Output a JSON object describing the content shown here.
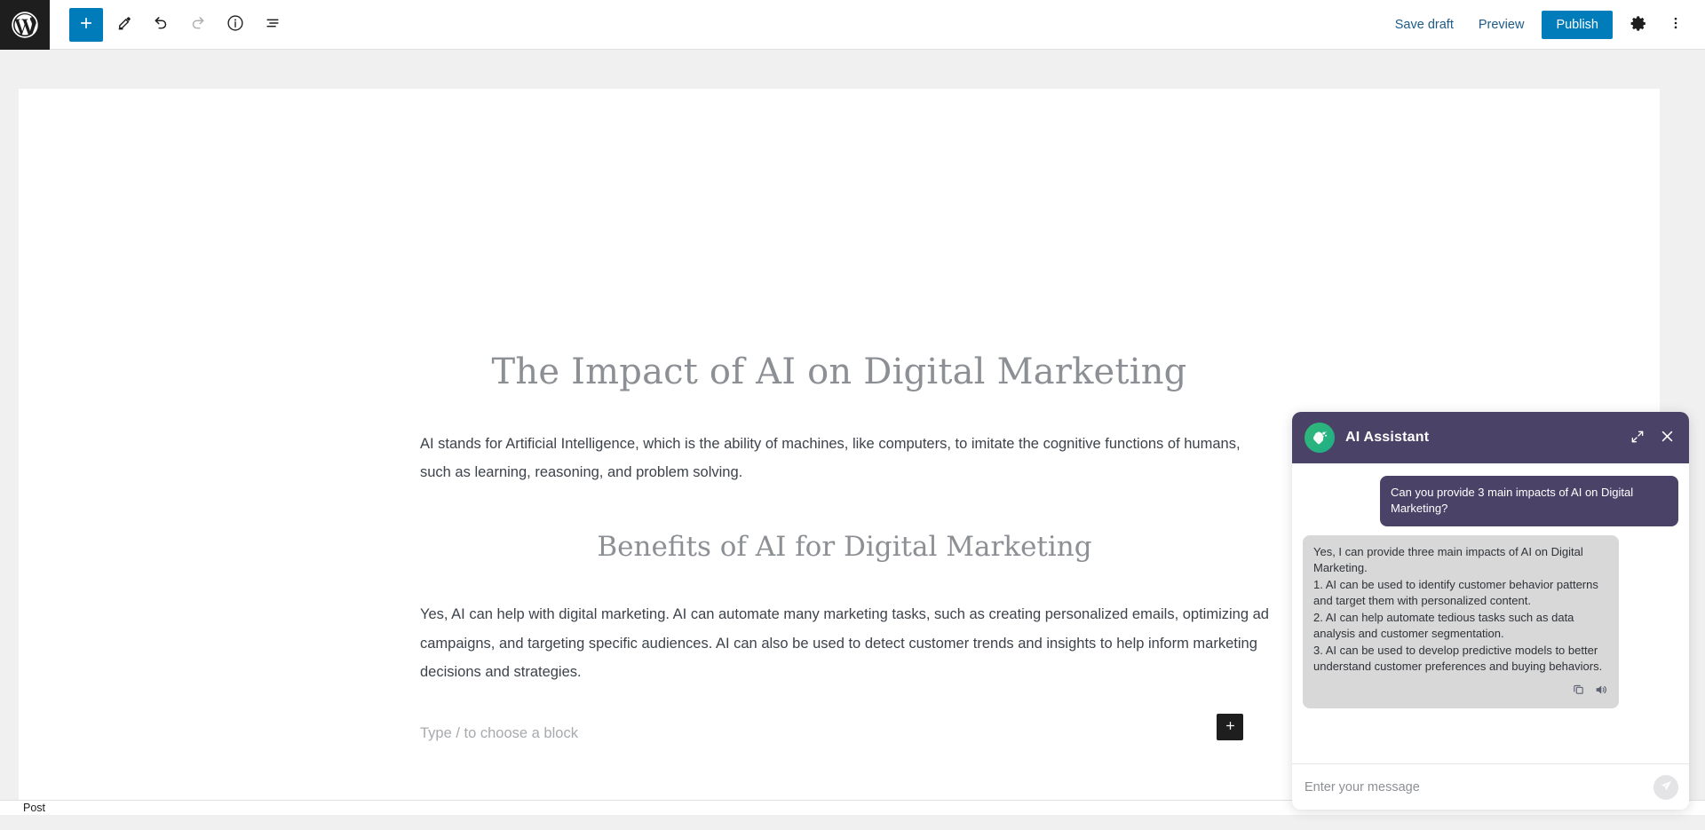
{
  "topbar": {
    "logo_icon": "wordpress-logo-icon",
    "tools": [
      {
        "name": "add-block-button",
        "icon": "plus-icon",
        "label": "Add block",
        "primary": true,
        "disabled": false
      },
      {
        "name": "tools-button",
        "icon": "pencil-icon",
        "label": "Tools",
        "primary": false,
        "disabled": false
      },
      {
        "name": "undo-button",
        "icon": "undo-arrow-icon",
        "label": "Undo",
        "primary": false,
        "disabled": false
      },
      {
        "name": "redo-button",
        "icon": "redo-arrow-icon",
        "label": "Redo",
        "primary": false,
        "disabled": true
      },
      {
        "name": "details-button",
        "icon": "info-circle-icon",
        "label": "Details",
        "primary": false,
        "disabled": false
      },
      {
        "name": "list-view-button",
        "icon": "list-view-icon",
        "label": "List View",
        "primary": false,
        "disabled": false
      }
    ],
    "save_draft_label": "Save draft",
    "preview_label": "Preview",
    "publish_label": "Publish",
    "settings_icon": "gear-icon",
    "options_icon": "more-vertical-icon",
    "accent_color": "#007cba",
    "logo_bg": "#1e1e1e"
  },
  "editor": {
    "post_title": "The Impact of AI on Digital Marketing",
    "paragraph_1": "AI stands for Artificial Intelligence, which is the ability of machines, like computers, to imitate the cognitive functions of humans, such as learning, reasoning, and problem solving.",
    "heading_2": "Benefits of AI for Digital Marketing",
    "paragraph_2": "Yes, AI can help with digital marketing. AI can automate many marketing tasks, such as creating personalized emails, optimizing ad campaigns, and targeting specific audiences. AI can also be used to detect customer trends and insights to help inform marketing decisions and strategies.",
    "block_placeholder": "Type / to choose a block",
    "inline_add_icon": "plus-icon"
  },
  "breadcrumb": {
    "crumb": "Post"
  },
  "ai_assistant": {
    "title": "AI Assistant",
    "avatar_icon": "ai-robot-avatar-icon",
    "expand_icon": "expand-diagonal-icon",
    "close_icon": "close-x-icon",
    "header_color": "#4b4267",
    "avatar_color": "#2bb07d",
    "messages": [
      {
        "role": "user",
        "text": "Can you provide 3 main impacts of AI on Digital Marketing?"
      },
      {
        "role": "assistant",
        "lines": [
          "Yes, I can provide three main impacts of AI on Digital Marketing.",
          "1. AI can be used to identify customer behavior patterns and target them with personalized content.",
          "2. AI can help automate tedious tasks such as data analysis and customer segmentation.",
          "3. AI can be used to develop predictive models to better understand customer preferences and buying behaviors."
        ],
        "actions": [
          {
            "name": "copy-button",
            "icon": "copy-icon"
          },
          {
            "name": "speak-button",
            "icon": "speaker-icon"
          }
        ]
      }
    ],
    "input_placeholder": "Enter your message",
    "input_value": "",
    "send_icon": "send-paper-plane-icon"
  }
}
